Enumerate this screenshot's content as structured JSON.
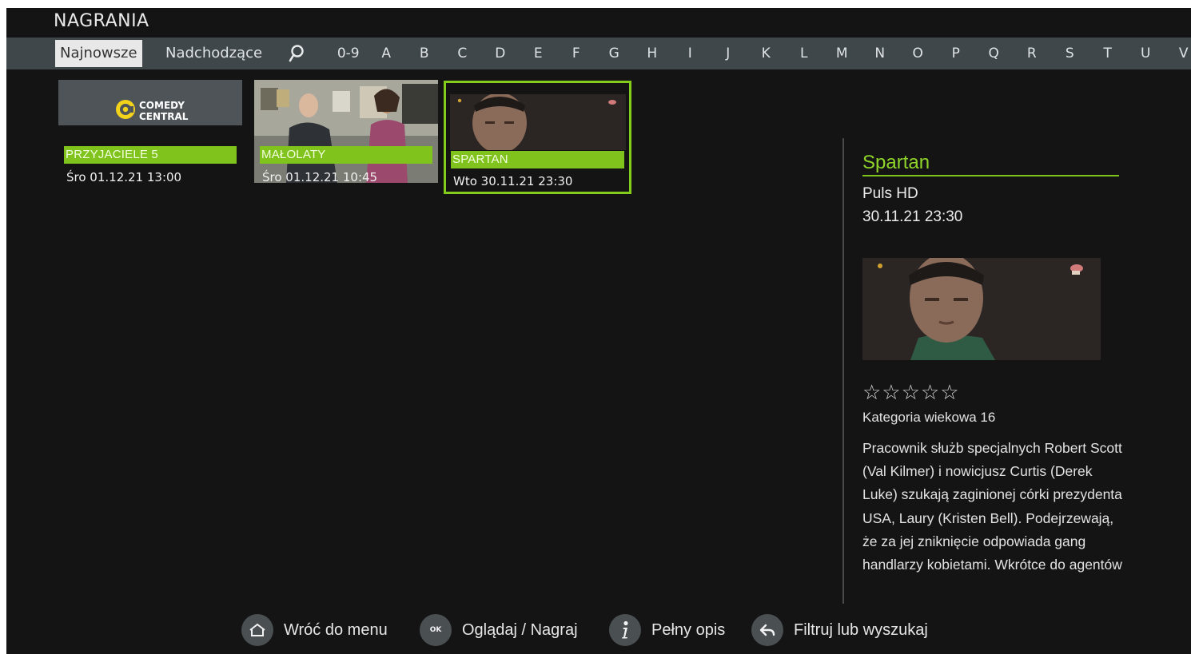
{
  "app": {
    "title": "NAGRANIA"
  },
  "nav": {
    "tabs": [
      {
        "label": "Najnowsze",
        "active": true
      },
      {
        "label": "Nadchodzące",
        "active": false
      }
    ],
    "search_icon": "search-icon",
    "letters": [
      "0-9",
      "A",
      "B",
      "C",
      "D",
      "E",
      "F",
      "G",
      "H",
      "I",
      "J",
      "K",
      "L",
      "M",
      "N",
      "O",
      "P",
      "Q",
      "R",
      "S",
      "T",
      "U",
      "V"
    ]
  },
  "recordings": [
    {
      "title": "PRZYJACIELE 5",
      "datetime": "Śro 01.12.21 13:00",
      "thumbnail": "channel logo",
      "logo_text": [
        "COMEDY",
        "CENTRAL"
      ]
    },
    {
      "title": "MAŁOLATY",
      "datetime": "Śro 01.12.21 10:45",
      "thumbnail": "scene still"
    },
    {
      "title": "SPARTAN",
      "datetime": "Wto 30.11.21 23:30",
      "thumbnail": "scene still",
      "focused": true
    }
  ],
  "details": {
    "title": "Spartan",
    "channel": "Puls HD",
    "datetime": "30.11.21 23:30",
    "rating_stars": "☆☆☆☆☆",
    "rating": 0,
    "rating_max": 5,
    "age_rating": "Kategoria wiekowa 16",
    "description": "Pracownik służb specjalnych Robert Scott (Val Kilmer) i nowicjusz Curtis (Derek Luke) szukają zaginionej córki prezydenta USA, Laury (Kristen Bell). Podejrzewają, że za jej zniknięcie odpowiada gang handlarzy kobietami. Wkrótce do agentów"
  },
  "hints": [
    {
      "icon": "home-icon",
      "label": "Wróć do menu"
    },
    {
      "icon": "ok-icon",
      "icon_text": "OK",
      "label": "Oglądaj / Nagraj"
    },
    {
      "icon": "info-icon",
      "label": "Pełny opis"
    },
    {
      "icon": "back-arrow-icon",
      "label": "Filtruj lub wyszukaj"
    }
  ],
  "colors": {
    "accent": "#7fc31c",
    "background": "#141414",
    "navbar": "#3f474b"
  }
}
